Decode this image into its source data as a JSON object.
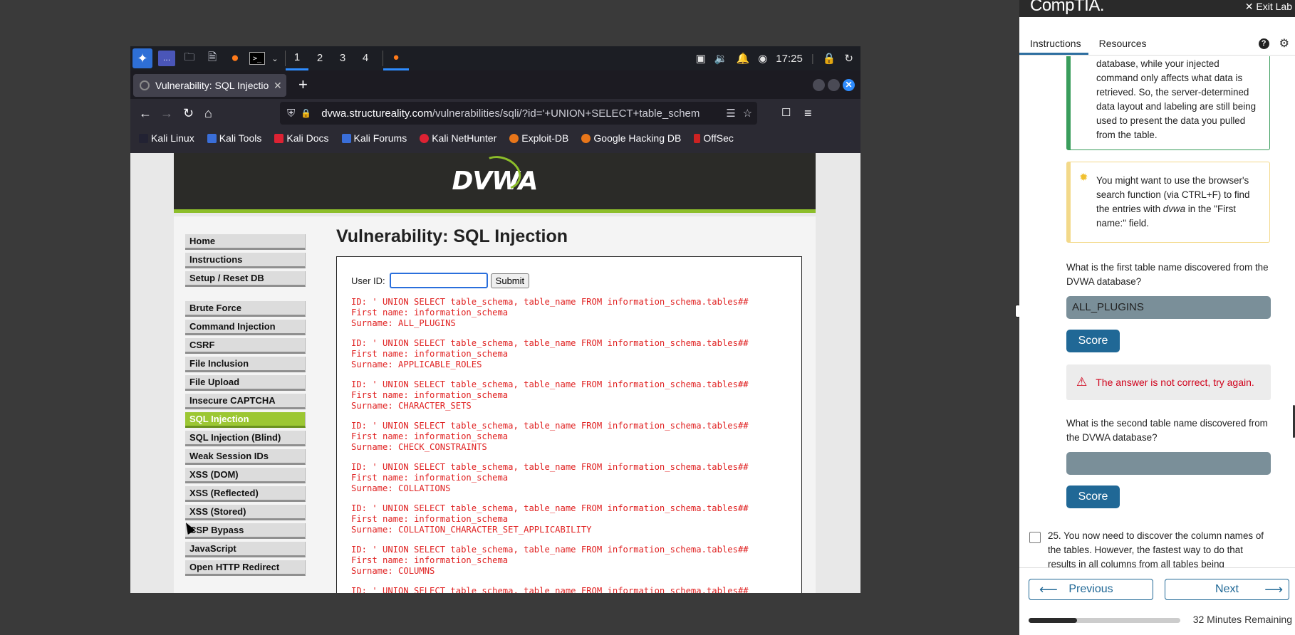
{
  "taskbar": {
    "workspaces": [
      "1",
      "2",
      "3",
      "4"
    ],
    "clock": "17:25"
  },
  "browser": {
    "tab_title": "Vulnerability: SQL Injectio",
    "url_host": "dvwa.structureality.com",
    "url_path": "/vulnerabilities/sqli/?id='+UNION+SELECT+table_schem",
    "bookmarks": [
      "Kali Linux",
      "Kali Tools",
      "Kali Docs",
      "Kali Forums",
      "Kali NetHunter",
      "Exploit-DB",
      "Google Hacking DB",
      "OffSec"
    ]
  },
  "dvwa": {
    "logo": "DVWA",
    "title": "Vulnerability: SQL Injection",
    "user_id_label": "User ID:",
    "user_id_value": "",
    "submit_label": "Submit",
    "menu_group1": [
      "Home",
      "Instructions",
      "Setup / Reset DB"
    ],
    "menu_group2": [
      "Brute Force",
      "Command Injection",
      "CSRF",
      "File Inclusion",
      "File Upload",
      "Insecure CAPTCHA",
      "SQL Injection",
      "SQL Injection (Blind)",
      "Weak Session IDs",
      "XSS (DOM)",
      "XSS (Reflected)",
      "XSS (Stored)",
      "CSP Bypass",
      "JavaScript",
      "Open HTTP Redirect"
    ],
    "selected_menu": "SQL Injection",
    "query_line": "ID: ' UNION SELECT table_schema, table_name FROM information_schema.tables##",
    "first_name_line": "First name: information_schema",
    "surnames": [
      "Surname: ALL_PLUGINS",
      "Surname: APPLICABLE_ROLES",
      "Surname: CHARACTER_SETS",
      "Surname: CHECK_CONSTRAINTS",
      "Surname: COLLATIONS",
      "Surname: COLLATION_CHARACTER_SET_APPLICABILITY",
      "Surname: COLUMNS"
    ]
  },
  "panel": {
    "brand": "CompTIA.",
    "exit": "Exit Lab",
    "tabs": [
      "Instructions",
      "Resources"
    ],
    "green_note": "database, while your injected command only affects what data is retrieved. So, the server-determined data layout and labeling are still being used to present the data you pulled from the table.",
    "yellow_note_a": "You might want to use the browser's search function (via CTRL+F) to find the entries with ",
    "yellow_note_em": "dvwa",
    "yellow_note_b": " in the \"First name:\" field.",
    "q1": "What is the first table name discovered from the DVWA database?",
    "q1_answer": "ALL_PLUGINS",
    "score_label": "Score",
    "error": "The answer is not correct, try again.",
    "q2": "What is the second table name discovered from the DVWA database?",
    "q2_answer": "",
    "q25_num": "25.",
    "q25_text": "You now need to discover the column names of the tables. However, the fastest way to do that results in all columns from all tables being",
    "previous": "Previous",
    "next": "Next",
    "progress": 0.32,
    "time_remaining": "32 Minutes Remaining"
  }
}
